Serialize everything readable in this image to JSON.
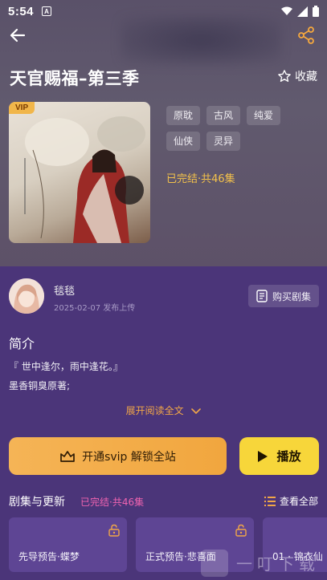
{
  "status_bar": {
    "time": "5:54",
    "notification_glyph": "A"
  },
  "header": {
    "back_icon": "arrow-left-icon",
    "share_icon": "share-icon"
  },
  "show": {
    "title": "天官赐福–第三季",
    "favorite_label": "收藏",
    "cover_badge": "VIP",
    "tags": [
      "原耽",
      "古风",
      "纯爱",
      "仙侠",
      "灵异"
    ],
    "status": "已完结·共46集"
  },
  "uploader": {
    "name": "毯毯",
    "date": "2025-02-07 发布上传",
    "buy_label": "购买剧集"
  },
  "intro": {
    "title": "简介",
    "line1": "『 世中逢尔，雨中逢花。』",
    "line2": "墨香铜臭原著;",
    "expand": "展开阅读全文"
  },
  "actions": {
    "vip_label": "开通svip 解锁全站",
    "play_label": "播放"
  },
  "episodes": {
    "heading": "剧集与更新",
    "status": "已完结·共46集",
    "see_all": "查看全部",
    "items": [
      {
        "label": "先导预告·蝶梦"
      },
      {
        "label": "正式预告·悲喜面"
      },
      {
        "label": "01 · 锦衣仙"
      }
    ]
  },
  "watermark": {
    "text": "一叮下载"
  },
  "colors": {
    "accent_orange": "#f1a63e",
    "play_yellow": "#f7d63a",
    "pink_status": "#ef63b0",
    "gold_status": "#f3c14b",
    "panel_bg": "#4b3579"
  }
}
